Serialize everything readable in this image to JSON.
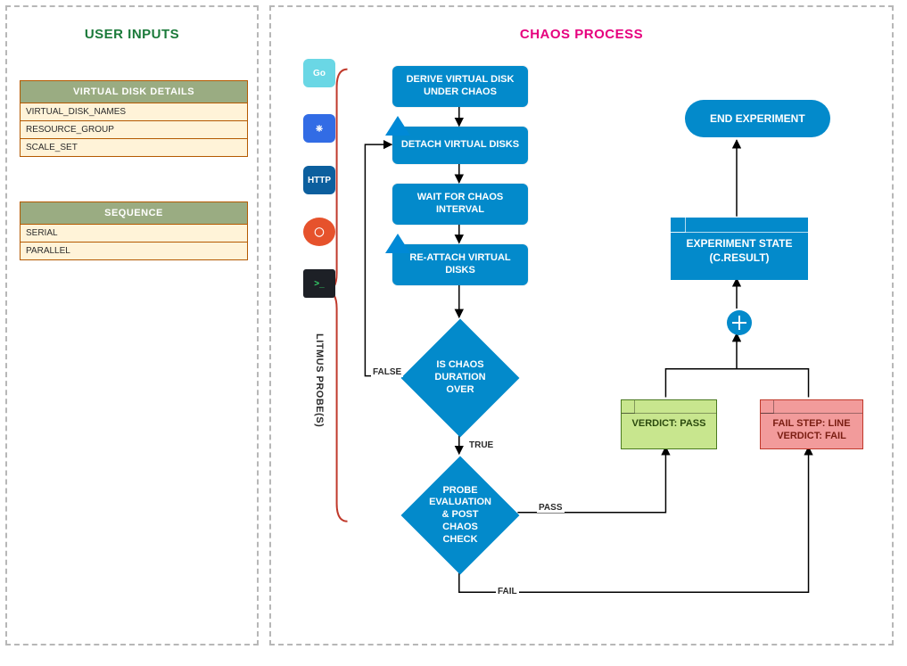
{
  "panels": {
    "left_title": "USER INPUTS",
    "right_title": "CHAOS PROCESS"
  },
  "tables": {
    "vdisk": {
      "header": "VIRTUAL DISK DETAILS",
      "rows": [
        "VIRTUAL_DISK_NAMES",
        "RESOURCE_GROUP",
        "SCALE_SET"
      ]
    },
    "sequence": {
      "header": "SEQUENCE",
      "rows": [
        "SERIAL",
        "PARALLEL"
      ]
    }
  },
  "probes_label": "LITMUS PROBE(S)",
  "tech_icons": {
    "go": {
      "name": "go-gopher-icon",
      "bg": "#6ad7e5",
      "glyph": "Go"
    },
    "kubernetes": {
      "name": "kubernetes-icon",
      "bg": "#326ce5",
      "glyph": "⎈"
    },
    "http": {
      "name": "http-icon",
      "bg": "#0c5f9e",
      "glyph": "HTTP"
    },
    "prometheus": {
      "name": "prometheus-icon",
      "bg": "#e6522c",
      "glyph": "◯"
    },
    "terminal": {
      "name": "terminal-icon",
      "bg": "#1d2026",
      "glyph": ">_"
    }
  },
  "azure_badge_name": "azure-icon",
  "flow": {
    "derive": "DERIVE VIRTUAL DISK UNDER CHAOS",
    "detach": "DETACH VIRTUAL DISKS",
    "wait": "WAIT FOR CHAOS INTERVAL",
    "reattach": "RE-ATTACH VIRTUAL DISKS",
    "duration": "IS CHAOS DURATION OVER",
    "probe": "PROBE EVALUATION & POST CHAOS CHECK",
    "pass": "VERDICT: PASS",
    "fail": "FAIL STEP: LINE VERDICT: FAIL",
    "result": "EXPERIMENT STATE (C.RESULT)",
    "end": "END EXPERIMENT"
  },
  "edge_labels": {
    "false": "FALSE",
    "true": "TRUE",
    "pass": "PASS",
    "fail": "FAIL"
  }
}
